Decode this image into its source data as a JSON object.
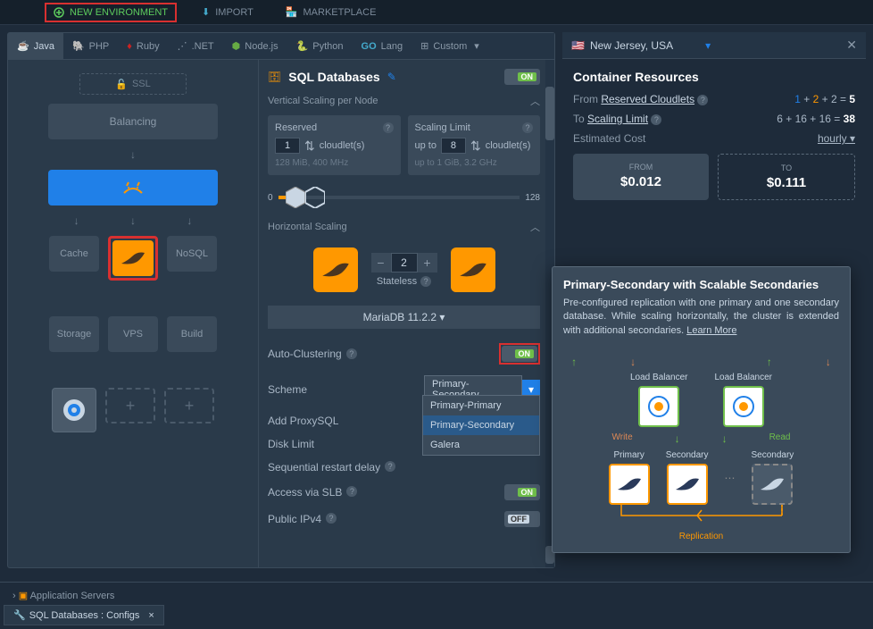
{
  "toolbar": {
    "new_env": "NEW ENVIRONMENT",
    "import": "IMPORT",
    "marketplace": "MARKETPLACE"
  },
  "langs": [
    "Java",
    "PHP",
    "Ruby",
    ".NET",
    "Node.js",
    "Python",
    "Lang",
    "Custom"
  ],
  "topology": {
    "ssl": "SSL",
    "balancing": "Balancing",
    "cache": "Cache",
    "nosql": "NoSQL",
    "storage": "Storage",
    "vps": "VPS",
    "build": "Build"
  },
  "config": {
    "title": "SQL Databases",
    "vertical": "Vertical Scaling per Node",
    "reserved": "Reserved",
    "reserved_val": "1",
    "cloudlets": "cloudlet(s)",
    "reserved_specs": "128 MiB, 400 MHz",
    "scaling_limit": "Scaling Limit",
    "limit_upto": "up to",
    "limit_val": "8",
    "limit_specs": "up to 1 GiB, 3.2 GHz",
    "slider_min": "0",
    "slider_max": "128",
    "horizontal": "Horizontal Scaling",
    "hscale_val": "2",
    "stateless": "Stateless",
    "db_version": "MariaDB 11.2.2",
    "auto_cluster": "Auto-Clustering",
    "scheme": "Scheme",
    "scheme_val": "Primary-Secondary",
    "scheme_options": [
      "Primary-Primary",
      "Primary-Secondary",
      "Galera"
    ],
    "add_proxy": "Add ProxySQL",
    "disk_limit": "Disk Limit",
    "seq_restart": "Sequential restart delay",
    "access_slb": "Access via SLB",
    "public_ipv4": "Public IPv4",
    "on": "ON",
    "off": "OFF"
  },
  "region": {
    "name": "New Jersey, USA"
  },
  "resources": {
    "title": "Container Resources",
    "from_label": "From",
    "reserved_link": "Reserved Cloudlets",
    "from_calc": "1 + 2 + 2 = ",
    "from_total": "5",
    "to_label": "To",
    "limit_link": "Scaling Limit",
    "to_calc": "6 + 16 + 16 = ",
    "to_total": "38",
    "est_cost": "Estimated Cost",
    "hourly": "hourly",
    "cost_from_lbl": "FROM",
    "cost_from": "$0.012",
    "cost_to_lbl": "TO",
    "cost_to": "$0.111"
  },
  "tooltip": {
    "title": "Primary-Secondary with Scalable Secondaries",
    "desc": "Pre-configured replication with one primary and one secondary database. While scaling horizontally, the cluster is extended with additional secondaries. ",
    "learn": "Learn More",
    "lb": "Load Balancer",
    "primary": "Primary",
    "secondary": "Secondary",
    "write": "Write",
    "read": "Read",
    "replication": "Replication"
  },
  "bottom": {
    "tree": "Application Servers",
    "tab": "SQL Databases : Configs"
  }
}
